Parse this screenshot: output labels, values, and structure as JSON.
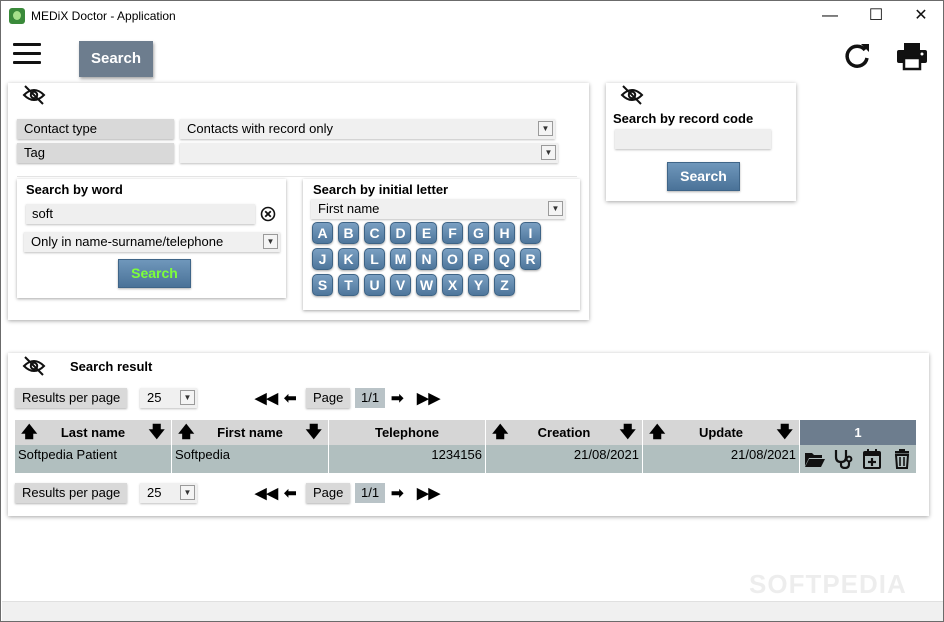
{
  "window": {
    "title": "MEDiX Doctor - Application",
    "minimize": "—",
    "maximize": "☐",
    "close": "✕"
  },
  "toolbar": {
    "search_label": "Search",
    "icons": [
      "menu-icon",
      "refresh-icon",
      "print-icon"
    ]
  },
  "filters": {
    "contact_type_label": "Contact type",
    "contact_type_value": "Contacts with record only",
    "tag_label": "Tag",
    "tag_value": ""
  },
  "search_by_word": {
    "heading": "Search by word",
    "value": "soft",
    "scope": "Only in name-surname/telephone",
    "button": "Search"
  },
  "search_by_letter": {
    "heading": "Search by initial letter",
    "field": "First name",
    "letters": [
      "A",
      "B",
      "C",
      "D",
      "E",
      "F",
      "G",
      "H",
      "I",
      "J",
      "K",
      "L",
      "M",
      "N",
      "O",
      "P",
      "Q",
      "R",
      "S",
      "T",
      "U",
      "V",
      "W",
      "X",
      "Y",
      "Z"
    ]
  },
  "search_by_code": {
    "heading": "Search by record code",
    "value": "",
    "button": "Search"
  },
  "results": {
    "heading": "Search result",
    "per_page_label": "Results per page",
    "per_page_value": "25",
    "page_label": "Page",
    "page_value": "1/1",
    "columns": [
      "Last name",
      "First name",
      "Telephone",
      "Creation",
      "Update"
    ],
    "actions_header": "1",
    "rows": [
      {
        "last_name": "Softpedia Patient",
        "first_name": "Softpedia",
        "telephone": "1234156",
        "creation": "21/08/2021",
        "update": "21/08/2021"
      }
    ],
    "row_actions": [
      "open-folder-icon",
      "stethoscope-icon",
      "calendar-add-icon",
      "trash-icon"
    ]
  },
  "watermark": "SOFTPEDIA",
  "colors": {
    "button_blue": "#4a7298",
    "top_button": "#6d7d8e",
    "grid_header": "#d6d6d6",
    "grid_row": "#b1bfbf",
    "actions_header": "#6d7d8e",
    "letter_search_text": "#7dff3a"
  }
}
